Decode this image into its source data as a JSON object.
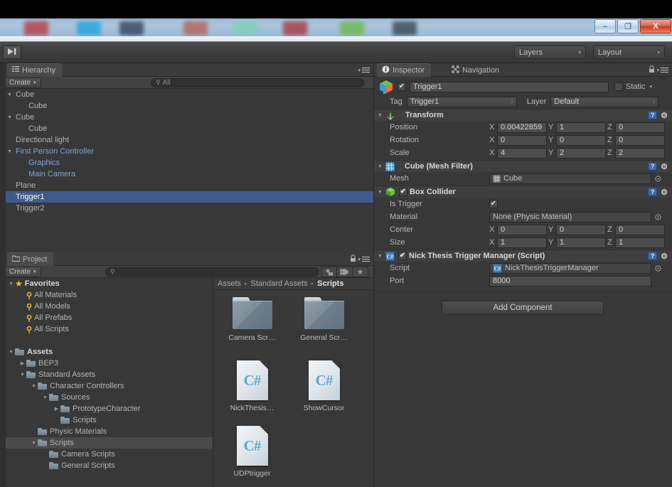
{
  "window": {
    "min_label": "–",
    "restore_label": "❐",
    "close_label": "X"
  },
  "toolbar": {
    "step_icon": "step-forward-icon",
    "layers_label": "Layers",
    "layout_label": "Layout",
    "dropdown_arrow": "▾"
  },
  "hierarchy": {
    "tab_label": "Hierarchy",
    "tab_icon": "hierarchy-icon",
    "create_label": "Create",
    "create_arrow": "▾",
    "search_placeholder": "All",
    "search_value": "All",
    "menu_icon": "panel-menu-icon",
    "items": [
      {
        "label": "Cube",
        "indent": 0,
        "expanded": true,
        "prefab": false,
        "selected": false
      },
      {
        "label": "Cube",
        "indent": 1,
        "expanded": null,
        "prefab": false,
        "selected": false
      },
      {
        "label": "Cube",
        "indent": 0,
        "expanded": true,
        "prefab": false,
        "selected": false
      },
      {
        "label": "Cube",
        "indent": 1,
        "expanded": null,
        "prefab": false,
        "selected": false
      },
      {
        "label": "Directional light",
        "indent": 0,
        "expanded": null,
        "prefab": false,
        "selected": false
      },
      {
        "label": "First Person Controller",
        "indent": 0,
        "expanded": true,
        "prefab": true,
        "selected": false
      },
      {
        "label": "Graphics",
        "indent": 1,
        "expanded": null,
        "prefab": true,
        "selected": false
      },
      {
        "label": "Main Camera",
        "indent": 1,
        "expanded": null,
        "prefab": true,
        "selected": false
      },
      {
        "label": "Plane",
        "indent": 0,
        "expanded": null,
        "prefab": false,
        "selected": false
      },
      {
        "label": "Trigger1",
        "indent": 0,
        "expanded": null,
        "prefab": false,
        "selected": true
      },
      {
        "label": "Trigger2",
        "indent": 0,
        "expanded": null,
        "prefab": false,
        "selected": false
      }
    ]
  },
  "project": {
    "tab_label": "Project",
    "tab_icon": "folder-icon",
    "create_label": "Create",
    "create_arrow": "▾",
    "search_placeholder": "",
    "search_value": "",
    "lock_icon": "lock-icon",
    "menu_icon": "panel-menu-icon",
    "filter_icons": [
      "object-filter-icon",
      "label-filter-icon",
      "favorites-star-icon"
    ],
    "tree": [
      {
        "label": "Favorites",
        "indent": 0,
        "icon": "star",
        "expanded": true,
        "bold": true,
        "selected": false
      },
      {
        "label": "All Materials",
        "indent": 1,
        "icon": "search",
        "expanded": null,
        "bold": false,
        "selected": false
      },
      {
        "label": "All Models",
        "indent": 1,
        "icon": "search",
        "expanded": null,
        "bold": false,
        "selected": false
      },
      {
        "label": "All Prefabs",
        "indent": 1,
        "icon": "search",
        "expanded": null,
        "bold": false,
        "selected": false
      },
      {
        "label": "All Scripts",
        "indent": 1,
        "icon": "search",
        "expanded": null,
        "bold": false,
        "selected": false
      },
      {
        "label": "",
        "indent": 0,
        "icon": "none",
        "expanded": null,
        "bold": false,
        "selected": false
      },
      {
        "label": "Assets",
        "indent": 0,
        "icon": "folder",
        "expanded": true,
        "bold": true,
        "selected": false
      },
      {
        "label": "BEP3",
        "indent": 1,
        "icon": "folder",
        "expanded": false,
        "bold": false,
        "selected": false
      },
      {
        "label": "Standard Assets",
        "indent": 1,
        "icon": "folder",
        "expanded": true,
        "bold": false,
        "selected": false
      },
      {
        "label": "Character Controllers",
        "indent": 2,
        "icon": "folder",
        "expanded": true,
        "bold": false,
        "selected": false
      },
      {
        "label": "Sources",
        "indent": 3,
        "icon": "folder",
        "expanded": true,
        "bold": false,
        "selected": false
      },
      {
        "label": "PrototypeCharacter",
        "indent": 4,
        "icon": "folder",
        "expanded": false,
        "bold": false,
        "selected": false
      },
      {
        "label": "Scripts",
        "indent": 4,
        "icon": "folder",
        "expanded": null,
        "bold": false,
        "selected": false
      },
      {
        "label": "Physic Materials",
        "indent": 2,
        "icon": "folder",
        "expanded": null,
        "bold": false,
        "selected": false
      },
      {
        "label": "Scripts",
        "indent": 2,
        "icon": "folder",
        "expanded": true,
        "bold": false,
        "selected": true
      },
      {
        "label": "Camera Scripts",
        "indent": 3,
        "icon": "folder",
        "expanded": null,
        "bold": false,
        "selected": false
      },
      {
        "label": "General Scripts",
        "indent": 3,
        "icon": "folder",
        "expanded": null,
        "bold": false,
        "selected": false
      }
    ],
    "breadcrumb": [
      "Assets",
      "Standard Assets",
      "Scripts"
    ],
    "breadcrumb_sep": "▸",
    "assets": [
      {
        "name": "Camera Scr…",
        "kind": "folder"
      },
      {
        "name": "General Scr…",
        "kind": "folder"
      },
      {
        "name": "NickThesis…",
        "kind": "csharp",
        "glyph": "C#"
      },
      {
        "name": "ShowCursor",
        "kind": "csharp",
        "glyph": "C#"
      },
      {
        "name": "UDPtrigger",
        "kind": "csharp",
        "glyph": "C#"
      }
    ]
  },
  "inspector": {
    "tabs": [
      {
        "label": "Inspector",
        "icon": "info-icon",
        "active": true
      },
      {
        "label": "Navigation",
        "icon": "navigation-icon",
        "active": false
      }
    ],
    "lock_icon": "lock-icon",
    "menu_icon": "panel-menu-icon",
    "object": {
      "icon": "gameobject-cube-icon",
      "enabled": true,
      "check_glyph": "✔",
      "name": "Trigger1",
      "static_label": "Static",
      "static_checked": false,
      "static_arrow": "▾",
      "tag_label": "Tag",
      "tag_value": "Trigger1",
      "layer_label": "Layer",
      "layer_value": "Default",
      "popup_arrow": "↕"
    },
    "components": [
      {
        "title": "Transform",
        "icon": "transform-gizmo-icon",
        "has_toggle": false,
        "expanded": true,
        "expand_arrow": "▼",
        "help_icon": "help-icon",
        "gear_icon": "gear-icon",
        "rows": [
          {
            "type": "vector3",
            "label": "Position",
            "axes": [
              "X",
              "Y",
              "Z"
            ],
            "values": [
              "0.00422859",
              "1",
              "0"
            ]
          },
          {
            "type": "vector3",
            "label": "Rotation",
            "axes": [
              "X",
              "Y",
              "Z"
            ],
            "values": [
              "0",
              "0",
              "0"
            ]
          },
          {
            "type": "vector3",
            "label": "Scale",
            "axes": [
              "X",
              "Y",
              "Z"
            ],
            "values": [
              "4",
              "2",
              "2"
            ]
          }
        ]
      },
      {
        "title": "Cube (Mesh Filter)",
        "icon": "mesh-filter-icon",
        "has_toggle": false,
        "expanded": true,
        "expand_arrow": "▼",
        "help_icon": "help-icon",
        "gear_icon": "gear-icon",
        "rows": [
          {
            "type": "object",
            "label": "Mesh",
            "value": "Cube",
            "value_icon": "mesh-icon",
            "picker_icon": "target-picker-icon"
          }
        ]
      },
      {
        "title": "Box Collider",
        "icon": "box-collider-icon",
        "has_toggle": true,
        "toggle_checked": true,
        "check_glyph": "✔",
        "expanded": true,
        "expand_arrow": "▼",
        "help_icon": "help-icon",
        "gear_icon": "gear-icon",
        "rows": [
          {
            "type": "bool",
            "label": "Is Trigger",
            "checked": true,
            "check_glyph": "✔"
          },
          {
            "type": "object",
            "label": "Material",
            "value": "None (Physic Material)",
            "value_icon": "",
            "picker_icon": "target-picker-icon"
          },
          {
            "type": "vector3",
            "label": "Center",
            "axes": [
              "X",
              "Y",
              "Z"
            ],
            "values": [
              "0",
              "0",
              "0"
            ]
          },
          {
            "type": "vector3",
            "label": "Size",
            "axes": [
              "X",
              "Y",
              "Z"
            ],
            "values": [
              "1",
              "1",
              "1"
            ]
          }
        ]
      },
      {
        "title": "Nick Thesis Trigger Manager (Script)",
        "icon": "csharp-script-icon",
        "has_toggle": true,
        "toggle_checked": true,
        "check_glyph": "✔",
        "expanded": true,
        "expand_arrow": "▼",
        "help_icon": "help-icon",
        "gear_icon": "gear-icon",
        "rows": [
          {
            "type": "object",
            "label": "Script",
            "value": "NickThesisTriggerManager",
            "value_icon": "csharp-script-icon",
            "picker_icon": "target-picker-icon"
          },
          {
            "type": "text",
            "label": "Port",
            "value": "8000"
          }
        ]
      }
    ],
    "add_component_label": "Add Component"
  },
  "colors": {
    "selection_blue": "#3f5a8a",
    "prefab_blue": "#7fa5d8",
    "panel_bg": "#383838",
    "favorite_gold": "#f5c518"
  }
}
